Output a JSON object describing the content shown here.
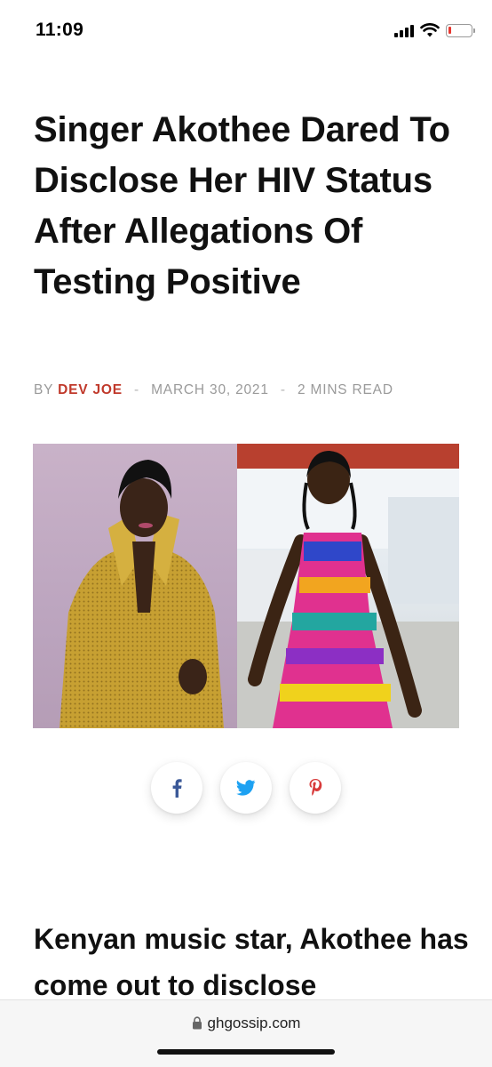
{
  "status_bar": {
    "time": "11:09",
    "battery_level": 0.1,
    "battery_color": "#e8372f"
  },
  "article": {
    "headline": "Singer Akothee Dared To Disclose Her HIV Status After Allegations Of Testing Positive",
    "meta": {
      "by_label": "BY",
      "author": "DEV JOE",
      "separator": "-",
      "date": "MARCH 30, 2021",
      "read_time": "2 MINS READ"
    },
    "lead_text": "Kenyan music star, Akothee has come out to disclose"
  },
  "share": {
    "facebook_icon": "facebook-icon",
    "twitter_icon": "twitter-icon",
    "pinterest_icon": "pinterest-icon",
    "colors": {
      "facebook": "#3b5998",
      "twitter": "#1da1f2",
      "pinterest": "#d83a3a"
    }
  },
  "browser": {
    "url": "ghgossip.com",
    "lock_icon": "lock-icon"
  },
  "colors": {
    "accent": "#c0392b",
    "meta_gray": "#9a9a9a"
  }
}
